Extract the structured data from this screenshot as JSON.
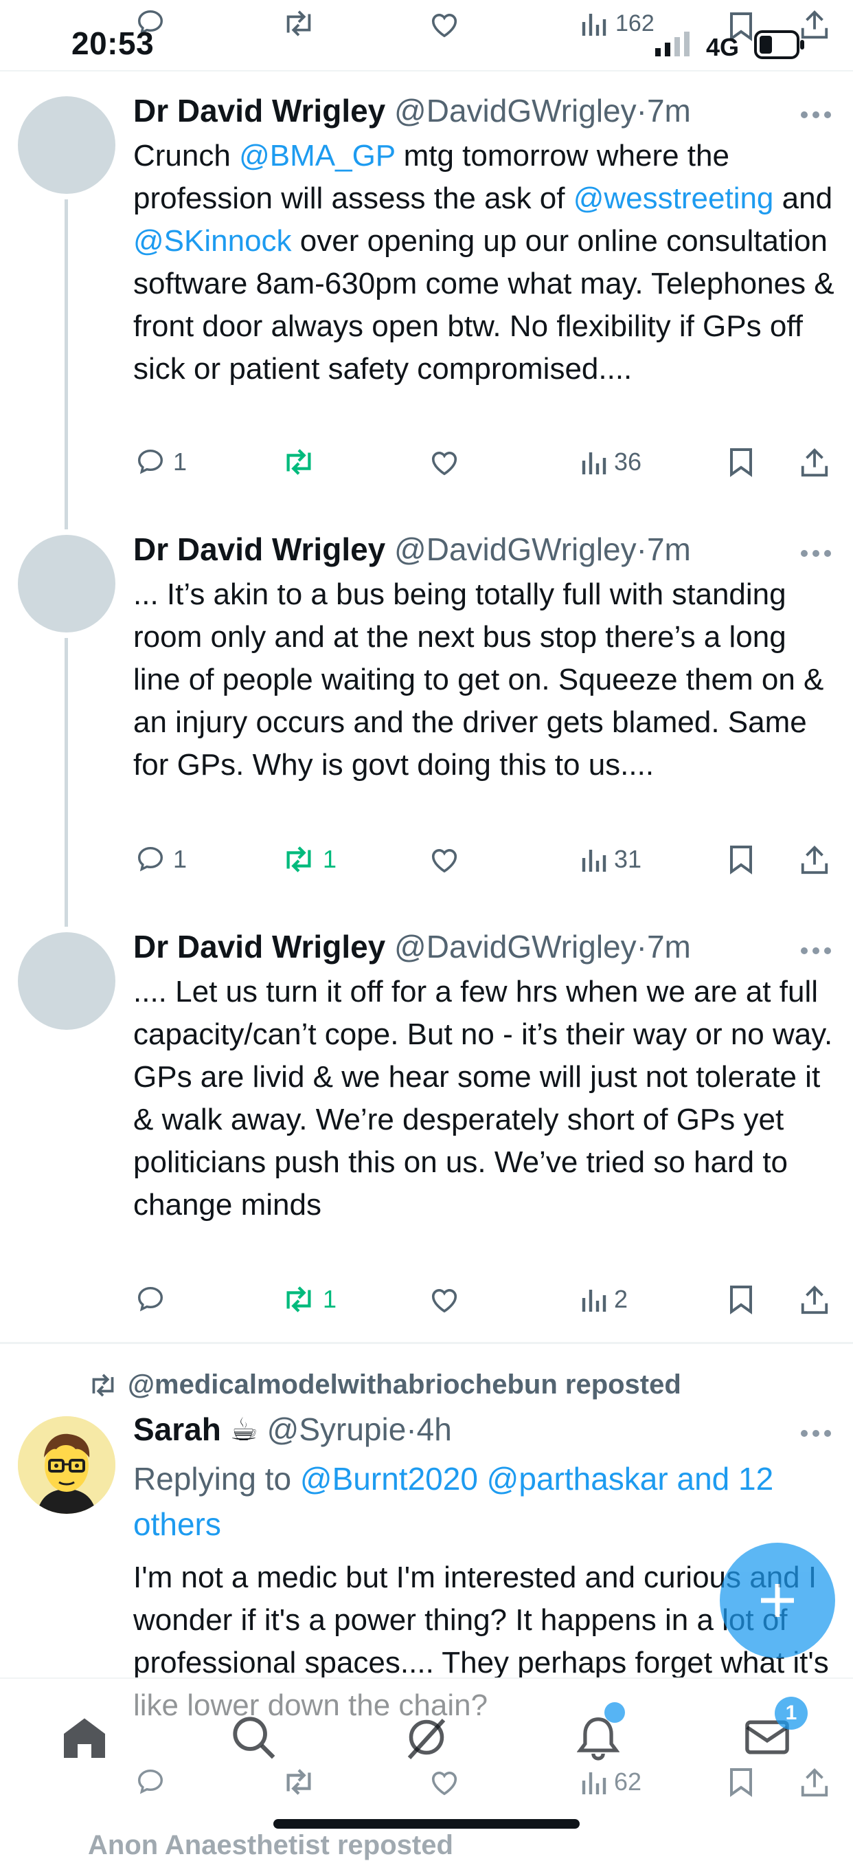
{
  "status_bar": {
    "time": "20:53",
    "network": "4G"
  },
  "top_partial": {
    "views": "162"
  },
  "thread_tweets": [
    {
      "name": "Dr David Wrigley",
      "handle": "@DavidGWrigley",
      "dot": "·",
      "time": "7m",
      "text_segments": [
        {
          "t": "Crunch ",
          "link": false
        },
        {
          "t": "@BMA_GP",
          "link": true
        },
        {
          "t": " mtg tomorrow where the profession will assess the ask of ",
          "link": false
        },
        {
          "t": "@wesstreeting",
          "link": true
        },
        {
          "t": " and ",
          "link": false
        },
        {
          "t": "@SKinnock",
          "link": true
        },
        {
          "t": " over opening up our online consultation software 8am-630pm come what may. Telephones & front door always open btw. No flexibility if GPs off sick or patient safety compromised....",
          "link": false
        }
      ],
      "replies": "1",
      "reposts": "",
      "views": "36"
    },
    {
      "name": "Dr David Wrigley",
      "handle": "@DavidGWrigley",
      "dot": "·",
      "time": "7m",
      "text_segments": [
        {
          "t": "... It’s akin to a bus being totally full with standing room only and at the next bus stop there’s a long line of people waiting to get on. Squeeze them on & an injury occurs and the driver gets blamed. Same for GPs. Why is govt doing this to us....",
          "link": false
        }
      ],
      "replies": "1",
      "reposts": "1",
      "views": "31"
    },
    {
      "name": "Dr David Wrigley",
      "handle": "@DavidGWrigley",
      "dot": "·",
      "time": "7m",
      "text_segments": [
        {
          "t": ".... Let us turn it off for a few hrs when we are at full capacity/can’t cope. But no - it’s their way or no way. GPs are livid & we hear some will just not tolerate it & walk away. We’re desperately short of GPs yet politicians push this on us. We’ve tried so hard to change minds",
          "link": false
        }
      ],
      "replies": "",
      "reposts": "1",
      "views": "2"
    }
  ],
  "repost_tweet": {
    "repost_label": "@medicalmodelwithabriochebun reposted",
    "name": "Sarah ☕",
    "handle": "@Syrupie",
    "dot": "·",
    "time": "4h",
    "replying_prefix": "Replying to ",
    "replying_handles": "@Burnt2020 @parthaskar and 12 others",
    "text": "I'm not a medic but I'm interested and curious and I wonder if it's a power thing? It happens in a lot of professional spaces.... They perhaps forget what it's like lower down the chain?",
    "views": "62"
  },
  "bottom_nav": {
    "notifications_badge": "",
    "messages_badge": "1"
  },
  "peek_text": "Anon Anaesthetist reposted",
  "colors": {
    "accent": "#1d9bf0",
    "repost_green": "#00ba7c",
    "secondary_text": "#536471",
    "avatar_placeholder": "#cfd9de"
  }
}
